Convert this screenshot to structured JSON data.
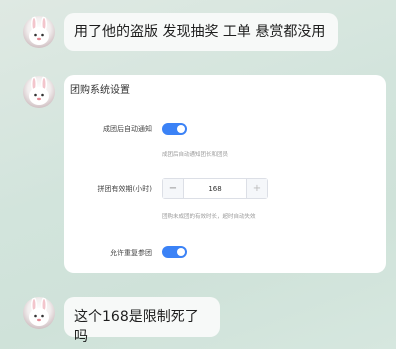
{
  "messages": [
    {
      "text": "用了他的盗版  发现抽奖 工单 悬赏都没用"
    },
    {
      "text": "这个168是限制死了吗"
    }
  ],
  "settings_card": {
    "title": "团购系统设置",
    "rows": [
      {
        "label": "成团后自动通知",
        "toggle_on": true,
        "hint": "成团后自动通知团长和团员"
      },
      {
        "label": "拼团有效期(小时)",
        "value": "168",
        "minus": "−",
        "plus": "+",
        "hint": "团购未成团的有效时长，超时自动失效"
      },
      {
        "label": "允许重复参团",
        "toggle_on": true
      }
    ]
  },
  "colors": {
    "toggle_accent": "#3b82f6",
    "bubble_bg": "#f7f9f8"
  },
  "icons": {
    "avatar": "rabbit-avatar-icon"
  }
}
